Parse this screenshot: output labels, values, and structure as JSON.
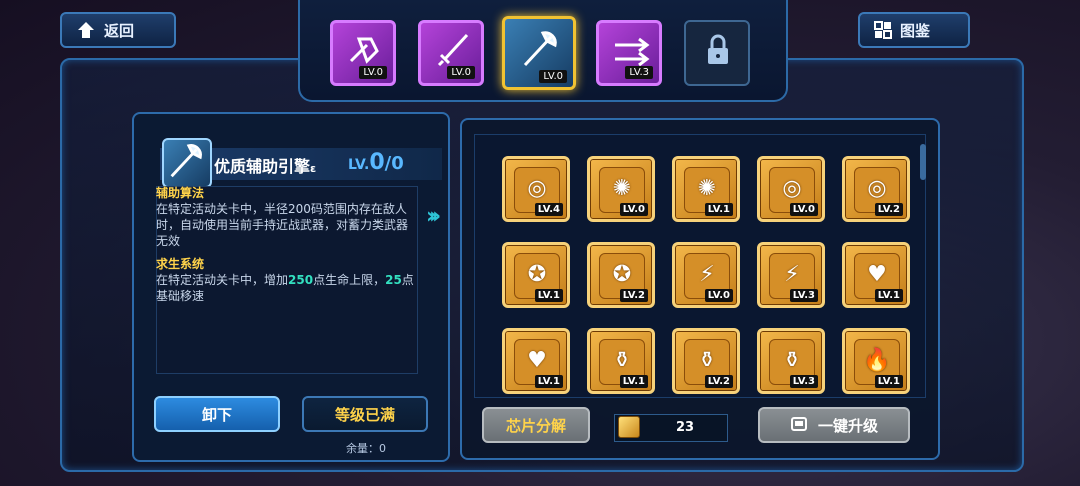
{
  "header": {
    "back_label": "返回",
    "atlas_label": "图鉴"
  },
  "weapon_tabs": [
    {
      "icon": "fist-icon",
      "level": "LV.0",
      "color": "#b443d9"
    },
    {
      "icon": "sword-icon",
      "level": "LV.0",
      "color": "#b443d9"
    },
    {
      "icon": "axe-icon",
      "level": "LV.0",
      "color": "#3a7fb4",
      "selected": true
    },
    {
      "icon": "crossbow-icon",
      "level": "LV.3",
      "color": "#b443d9"
    },
    {
      "icon": "lock-icon",
      "level": "",
      "locked": true
    }
  ],
  "engine": {
    "name": "优质辅助引擎",
    "name_suffix": "ε",
    "level_prefix": "LV.",
    "level_value": "0",
    "level_max": "/0",
    "sections": [
      {
        "title": "辅助算法",
        "text": "在特定活动关卡中，半径200码范围内存在敌人时，自动使用当前手持近战武器，对蓄力类武器无效"
      },
      {
        "title": "求生系统",
        "text_a": "在特定活动关卡中，增加",
        "hl1": "250",
        "text_b": "点生命上限，",
        "hl2": "25",
        "text_c": "点基础移速"
      }
    ],
    "unequip_label": "卸下",
    "maxed_label": "等级已满",
    "remaining_label": "余量：0"
  },
  "chips": [
    {
      "icon": "target-icon",
      "level": "LV.4"
    },
    {
      "icon": "vortex-icon",
      "level": "LV.0"
    },
    {
      "icon": "vortex-icon",
      "level": "LV.1"
    },
    {
      "icon": "target-icon",
      "level": "LV.0"
    },
    {
      "icon": "target-icon",
      "level": "LV.2"
    },
    {
      "icon": "pentagram-icon",
      "level": "LV.1"
    },
    {
      "icon": "pentagram-icon",
      "level": "LV.2"
    },
    {
      "icon": "lightning-icon",
      "level": "LV.0"
    },
    {
      "icon": "lightning-icon",
      "level": "LV.3"
    },
    {
      "icon": "heart-icon",
      "level": "LV.1"
    },
    {
      "icon": "heart-icon",
      "level": "LV.1"
    },
    {
      "icon": "potion-icon",
      "level": "LV.1"
    },
    {
      "icon": "potion-icon",
      "level": "LV.2"
    },
    {
      "icon": "potion-icon",
      "level": "LV.3"
    },
    {
      "icon": "fire-icon",
      "level": "LV.1"
    }
  ],
  "footer": {
    "decompose_label": "芯片分解",
    "currency_count": "23",
    "upgrade_all_label": "一键升级"
  }
}
